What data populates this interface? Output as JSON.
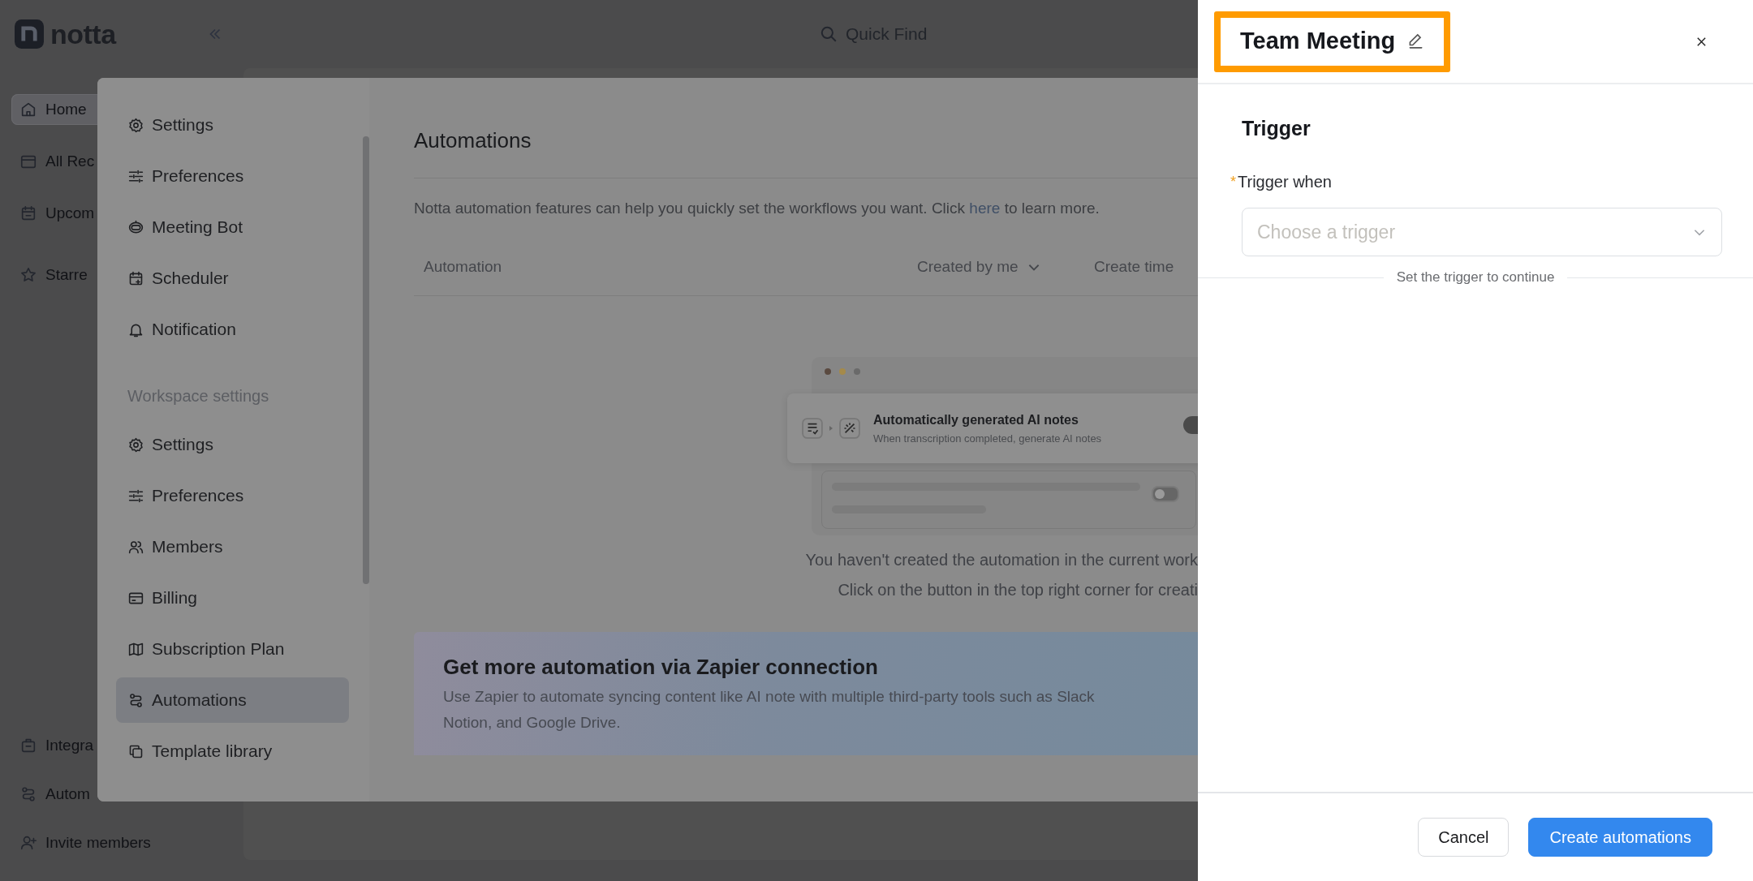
{
  "app": {
    "logo": "notta",
    "search": {
      "placeholder": "Quick Find"
    },
    "nav_top": [
      {
        "label": "Home",
        "selected": true
      },
      {
        "label": "All Rec",
        "selected": false
      },
      {
        "label": "Upcom",
        "selected": false
      },
      {
        "label": "Starre",
        "selected": false
      }
    ],
    "nav_bottom": [
      {
        "label": "Integra",
        "selected": false
      },
      {
        "label": "Autom",
        "selected": false
      },
      {
        "label": "Invite members",
        "selected": false
      }
    ]
  },
  "settings_modal": {
    "nav": [
      {
        "kind": "item",
        "label": "Settings",
        "selected": false
      },
      {
        "kind": "item",
        "label": "Preferences",
        "selected": false
      },
      {
        "kind": "item",
        "label": "Meeting Bot",
        "selected": false
      },
      {
        "kind": "item",
        "label": "Scheduler",
        "selected": false
      },
      {
        "kind": "item",
        "label": "Notification",
        "selected": false
      },
      {
        "kind": "heading",
        "label": "Workspace settings"
      },
      {
        "kind": "item",
        "label": "Settings",
        "selected": false
      },
      {
        "kind": "item",
        "label": "Preferences",
        "selected": false
      },
      {
        "kind": "item",
        "label": "Members",
        "selected": false
      },
      {
        "kind": "item",
        "label": "Billing",
        "selected": false
      },
      {
        "kind": "item",
        "label": "Subscription Plan",
        "selected": false
      },
      {
        "kind": "item",
        "label": "Automations",
        "selected": true
      },
      {
        "kind": "item",
        "label": "Template library",
        "selected": false
      }
    ],
    "content": {
      "title": "Automations",
      "description": {
        "before": "Notta automation features can help you quickly set the workflows you want. Click ",
        "link": "here",
        "after": " to learn more."
      },
      "columns": [
        {
          "label": "Automation",
          "dropdown": false
        },
        {
          "label": "Created by me",
          "dropdown": true
        },
        {
          "label": "Create time",
          "dropdown": false
        }
      ],
      "illustration": {
        "title": "Automatically generated AI notes",
        "subtitle": "When transcription completed, generate AI notes",
        "card_toggle_on": true,
        "row_toggle_on": false
      },
      "empty_message": [
        "You haven't created the automation in the current work",
        "Click on the button in the top right corner for creati"
      ],
      "banner": {
        "title": "Get more automation via Zapier connection",
        "lines": [
          "Use Zapier to automate syncing content like AI note with multiple third-party tools such as Slack",
          "Notion, and Google Drive."
        ]
      }
    }
  },
  "drawer": {
    "title": "Team Meeting",
    "highlighted": true,
    "section": "Trigger",
    "field": {
      "required_mark": "*",
      "label": "Trigger when",
      "placeholder": "Choose a trigger"
    },
    "hint": "Set the trigger to continue",
    "buttons": [
      {
        "label": "Cancel",
        "kind": "secondary"
      },
      {
        "label": "Create automations",
        "kind": "primary"
      }
    ]
  }
}
